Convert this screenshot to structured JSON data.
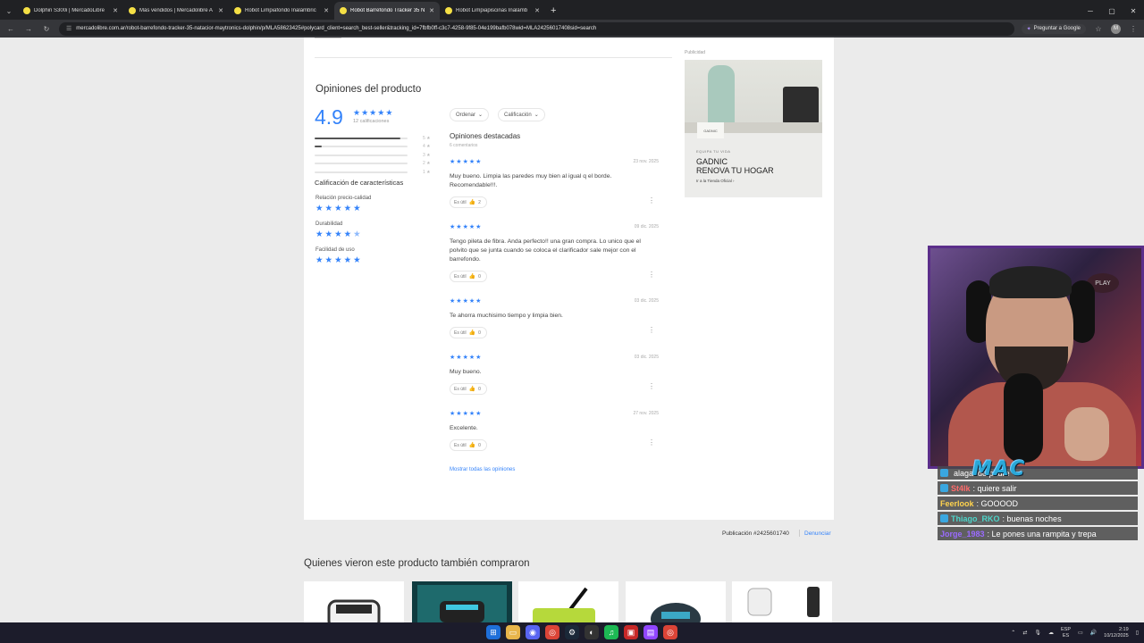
{
  "browser": {
    "tabs": [
      {
        "label": "Dolphin S300i | MercadoLibre",
        "active": false
      },
      {
        "label": "Más vendidos | Mercadolibre A",
        "active": false
      },
      {
        "label": "Robot Limpiafondo Inalámbric",
        "active": false
      },
      {
        "label": "Robot Barrefondo Tracker 35 N",
        "active": true
      },
      {
        "label": "Robot Limpiapiscinas Inalámb",
        "active": false
      }
    ],
    "url": "mercadolibre.com.ar/robot-barrefondo-tracker-35-natacior-maytronics-dolphin/p/MLA58623425#polycard_client=search_best-seller&tracking_id=7fbfb0ff-c3c7-4258-9f85-04e199bafb078wid=MLA24256017408sid=search",
    "ask_google": "Preguntar a Google",
    "profile_initial": "M"
  },
  "opinions": {
    "title": "Opiniones del producto",
    "average": "4.9",
    "ratings_count": "12 calificaciones",
    "histogram": [
      {
        "label": "5 ★",
        "fraction": 0.92
      },
      {
        "label": "4 ★",
        "fraction": 0.08
      },
      {
        "label": "3 ★",
        "fraction": 0
      },
      {
        "label": "2 ★",
        "fraction": 0
      },
      {
        "label": "1 ★",
        "fraction": 0
      }
    ],
    "features_title": "Calificación de características",
    "features": [
      {
        "label": "Relación precio-calidad",
        "stars": 5
      },
      {
        "label": "Durabilidad",
        "stars": 4.5
      },
      {
        "label": "Facilidad de uso",
        "stars": 5
      }
    ],
    "sort_label": "Ordenar",
    "rating_filter_label": "Calificación",
    "featured_title": "Opiniones destacadas",
    "featured_count": "6 comentarios",
    "useful_label": "Es útil",
    "reviews": [
      {
        "date": "23 nov. 2025",
        "text": "Muy bueno. Limpia las paredes muy bien al igual q el borde. Recomendable!!!.",
        "useful": "2"
      },
      {
        "date": "09 dic. 2025",
        "text": "Tengo pileta de fibra. Anda perfecto!! una gran compra. Lo unico que el polvito que se junta cuando se coloca el clarificador sale mejor con el barrefondo.",
        "useful": "0"
      },
      {
        "date": "03 dic. 2025",
        "text": "Te ahorra muchisimo tiempo y limpia bien.",
        "useful": "0"
      },
      {
        "date": "03 dic. 2025",
        "text": "Muy bueno.",
        "useful": "0"
      },
      {
        "date": "27 nov. 2025",
        "text": "Excelente.",
        "useful": "0"
      }
    ],
    "show_all": "Mostrar todas las opiniones"
  },
  "ad": {
    "label": "Publicidad",
    "kicker": "EQUIPA TU VIDA",
    "headline": "GADNIC\nRENOVA TU HOGAR",
    "link": "Ir a la Tienda Oficial ›",
    "sign": "GADNIC"
  },
  "footer": {
    "publication": "Publicación #2425601740",
    "report": "Denunciar"
  },
  "also_bought": {
    "title": "Quienes vieron este producto también compraron"
  },
  "stream": {
    "banner": "MAC",
    "cam_logo": "PLAY",
    "chat": [
      {
        "user": "",
        "message": "alagando padre",
        "color": "#9ad"
      },
      {
        "user": "St4lk",
        "message": ": quiere salir",
        "color": "#ff6b6b"
      },
      {
        "user": "Feerlook",
        "message": ": GOOOOD",
        "color": "#ffd34d"
      },
      {
        "user": "Thiago_RKO",
        "message": ": buenas noches",
        "color": "#4dd4c8"
      },
      {
        "user": "Jorge_1983",
        "message": ": Le pones una rampita y trepa",
        "color": "#9b6bff"
      }
    ]
  },
  "taskbar": {
    "lang_top": "ESP",
    "lang_bottom": "ES",
    "time": "2:19",
    "date": "10/12/2025"
  }
}
